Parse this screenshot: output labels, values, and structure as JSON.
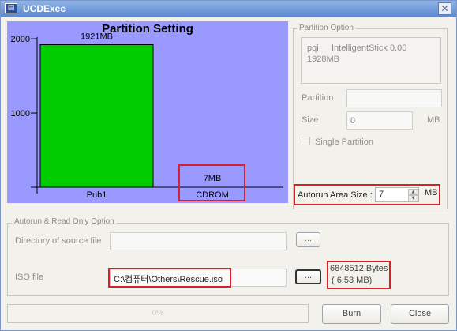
{
  "window": {
    "title": "UCDExec",
    "close_glyph": "✕",
    "icon_glyph": "▤"
  },
  "partition_chart": {
    "title": "Partition Setting",
    "y_ticks": [
      "2000",
      "1000"
    ],
    "bars": [
      {
        "category": "Pub1",
        "label": "1921MB"
      },
      {
        "category": "CDROM",
        "label": "7MB"
      }
    ]
  },
  "chart_data": {
    "type": "bar",
    "title": "Partition Setting",
    "categories": [
      "Pub1",
      "CDROM"
    ],
    "values": [
      1921,
      7
    ],
    "value_labels": [
      "1921MB",
      "7MB"
    ],
    "ylim": [
      0,
      2150
    ],
    "y_ticks": [
      1000,
      2000
    ],
    "colors": [
      "#00cc00",
      "#00cc00"
    ],
    "background": "#9999ff",
    "grid": false
  },
  "partition_option": {
    "legend": "Partition Option",
    "device_vendor": "pqi",
    "device_name": "IntelligentStick 0.00",
    "device_size": "1928MB",
    "partition_label": "Partition",
    "partition_value": "",
    "size_label": "Size",
    "size_value": "0",
    "size_unit": "MB",
    "single_partition_label": "Single Partition",
    "autorun_label": "Autorun Area Size :",
    "autorun_value": "7",
    "autorun_unit": "MB"
  },
  "autorun_section": {
    "legend": "Autorun & Read Only Option",
    "directory_label": "Directory of source file",
    "directory_value": "",
    "browse_label": "...",
    "iso_label": "ISO file",
    "iso_value": "C:\\컴퓨터\\Others\\Rescue.iso",
    "iso_browse_label": "...",
    "iso_bytes": "6848512 Bytes",
    "iso_mb": "( 6.53 MB)"
  },
  "footer": {
    "progress_text": "0%",
    "progress_value": 0,
    "burn_label": "Burn",
    "close_label": "Close"
  },
  "colors": {
    "chart_bg": "#9999ff",
    "bar": "#00cc00",
    "highlight": "#d9202a"
  }
}
